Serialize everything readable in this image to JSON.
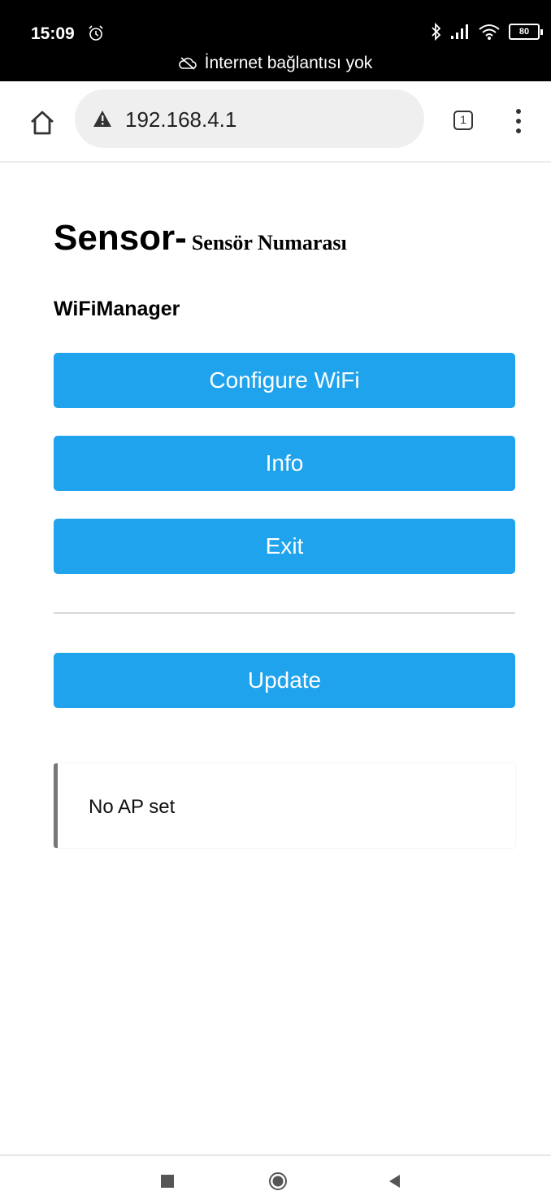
{
  "status_bar": {
    "time": "15:09",
    "battery": "80",
    "offline_text": "İnternet bağlantısı yok"
  },
  "browser": {
    "url": "192.168.4.1",
    "tab_count": "1"
  },
  "page": {
    "heading_main": "Sensor-",
    "heading_sub": "Sensör Numarası",
    "subtitle": "WiFiManager",
    "buttons": {
      "configure": "Configure WiFi",
      "info": "Info",
      "exit": "Exit",
      "update": "Update"
    },
    "message": "No AP set"
  },
  "colors": {
    "button": "#1fa3ec",
    "message_border": "#777777"
  },
  "icons": [
    "alarm-icon",
    "bluetooth-icon",
    "signal-icon",
    "wifi-icon",
    "battery-icon",
    "cloud-off-icon",
    "home-icon",
    "warning-icon",
    "tabs-icon",
    "menu-icon"
  ]
}
